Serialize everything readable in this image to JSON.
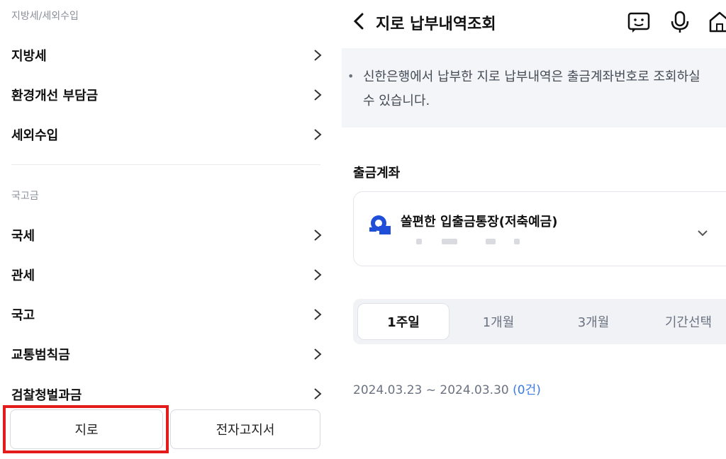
{
  "left_menu": {
    "sections": [
      {
        "title": "지방세/세외수입",
        "items": [
          {
            "label": "지방세"
          },
          {
            "label": "환경개선 부담금"
          },
          {
            "label": "세외수입"
          }
        ]
      },
      {
        "title": "국고금",
        "items": [
          {
            "label": "국세"
          },
          {
            "label": "관세"
          },
          {
            "label": "국고"
          },
          {
            "label": "교통범칙금"
          },
          {
            "label": "검찰청벌과금"
          }
        ]
      }
    ],
    "buttons": {
      "giro": "지로",
      "electronic_bill": "전자고지서"
    },
    "highlight_color": "#e41b1b"
  },
  "right_panel": {
    "header": {
      "title": "지로 납부내역조회",
      "icons": [
        "back-arrow-icon",
        "chatbot-icon",
        "microphone-icon",
        "home-icon"
      ]
    },
    "notice": "신한은행에서 납부한 지로 납부내역은 출금계좌번호로 조회하실\n수 있습니다.",
    "account": {
      "section_label": "출금계좌",
      "name": "쏠편한 입출금통장(저축예금)"
    },
    "period_tabs": [
      {
        "label": "1주일",
        "active": true
      },
      {
        "label": "1개월",
        "active": false
      },
      {
        "label": "3개월",
        "active": false
      },
      {
        "label": "기간선택",
        "active": false
      }
    ],
    "date_range": {
      "text": "2024.03.23 ~ 2024.03.30",
      "count": "(0건)"
    },
    "accent_color": "#3b7be3"
  }
}
